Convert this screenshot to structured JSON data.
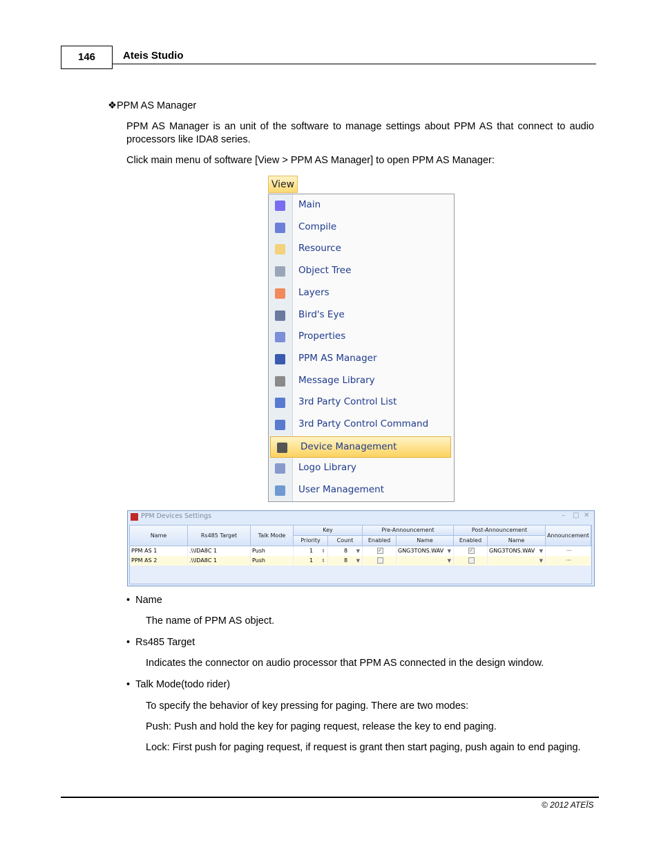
{
  "header": {
    "page_number": "146",
    "title": "Ateis Studio"
  },
  "section": {
    "bullet_glyph": "❖",
    "title": "PPM AS Manager",
    "intro": "PPM AS Manager is an unit of the software to manage settings about PPM AS that connect to audio processors like IDA8 series.",
    "instruction": "Click main menu of software [View > PPM AS Manager] to open PPM AS Manager:"
  },
  "menu": {
    "title": "View",
    "highlighted": "Device Management",
    "items": [
      {
        "label": "Main",
        "icon": "main-icon",
        "color": "#7a6cf0"
      },
      {
        "label": "Compile",
        "icon": "compile-icon",
        "color": "#6c7fd8"
      },
      {
        "label": "Resource",
        "icon": "folder-icon",
        "color": "#f2d27a"
      },
      {
        "label": "Object Tree",
        "icon": "tree-icon",
        "color": "#9aa6b8"
      },
      {
        "label": "Layers",
        "icon": "layers-icon",
        "color": "#f08a5a"
      },
      {
        "label": "Bird's Eye",
        "icon": "birds-eye-icon",
        "color": "#6a7aa0"
      },
      {
        "label": "Properties",
        "icon": "properties-icon",
        "color": "#7c8ed8"
      },
      {
        "label": "PPM AS Manager",
        "icon": "ppm-icon",
        "color": "#3a5ab0"
      },
      {
        "label": "Message Library",
        "icon": "music-icon",
        "color": "#8a8a8a"
      },
      {
        "label": "3rd Party Control List",
        "icon": "control-list-icon",
        "color": "#5a7ad0"
      },
      {
        "label": "3rd Party Control Command",
        "icon": "control-command-icon",
        "color": "#5a7ad0"
      },
      {
        "label": "Device Management",
        "icon": "device-management-icon",
        "color": "#555"
      },
      {
        "label": "Logo Library",
        "icon": "logo-icon",
        "color": "#8899cc"
      },
      {
        "label": "User Management",
        "icon": "user-icon",
        "color": "#6f9ad0"
      }
    ]
  },
  "window": {
    "title": "PPM Devices Settings",
    "controls": [
      "–",
      "□",
      "✕"
    ],
    "headers": {
      "name": "Name",
      "rs485": "Rs485 Target",
      "talk": "Talk Mode",
      "key": "Key",
      "priority": "Priority",
      "count": "Count",
      "pre": "Pre-Announcement",
      "pre_enabled": "Enabled",
      "pre_name": "Name",
      "post": "Post-Announcement",
      "post_enabled": "Enabled",
      "post_name": "Name",
      "announcement": "Announcement"
    },
    "rows": [
      {
        "name": "PPM AS 1",
        "rs485": ".\\\\IDA8C 1",
        "talk": "Push",
        "priority": "1",
        "count": "8",
        "pre_enabled": true,
        "pre_name": "GNG3TONS.WAV",
        "post_enabled": true,
        "post_name": "GNG3TONS.WAV",
        "announcement": "···"
      },
      {
        "name": "PPM AS 2",
        "rs485": ".\\\\IDA8C 1",
        "talk": "Push",
        "priority": "1",
        "count": "8",
        "pre_enabled": false,
        "pre_name": "",
        "post_enabled": false,
        "post_name": "",
        "announcement": "···"
      }
    ]
  },
  "fields": [
    {
      "bullet": "•",
      "title": "Name",
      "desc": [
        "The name of PPM AS object."
      ]
    },
    {
      "bullet": "•",
      "title": "Rs485 Target",
      "desc": [
        "Indicates the connector on audio processor that PPM AS connected in the design window."
      ]
    },
    {
      "bullet": "•",
      "title": "Talk Mode(todo rider)",
      "desc": [
        "To specify the behavior of key pressing for paging. There are two modes:",
        "Push: Push and hold the key for paging request, release the key to end paging.",
        "Lock: First push for paging request, if request is grant then start paging, push again to end paging."
      ]
    }
  ],
  "footer": {
    "copyright": "© 2012 ATEÏS"
  }
}
